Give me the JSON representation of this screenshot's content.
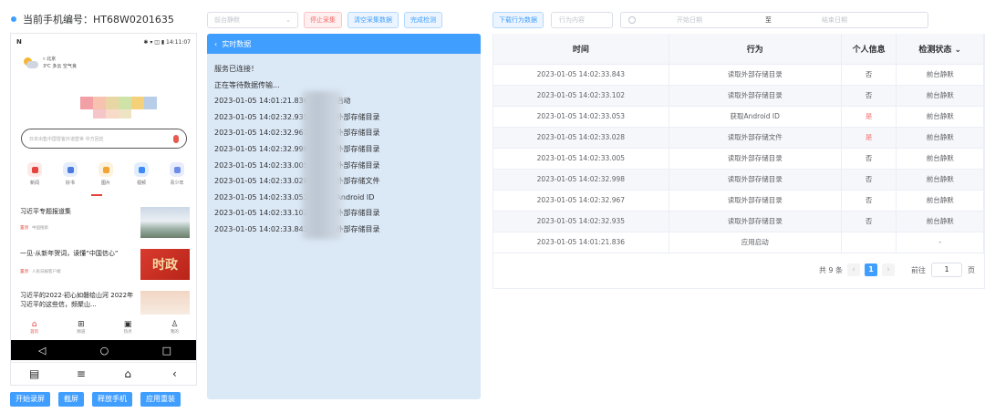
{
  "device": {
    "label": "当前手机编号：HT68W0201635",
    "status_bar": {
      "left": "N",
      "right": "✱ ▾ ◫ ▮ 14:11:07"
    },
    "weather": {
      "city": "▿ 北京",
      "info": "3℃ 多云 空气良"
    },
    "search_placeholder": "日本出售中国冒客外道塑世 中方回应",
    "icons": [
      {
        "label": "新闻",
        "bg": "#fde9e8",
        "fg": "#e5433b"
      },
      {
        "label": "好书",
        "bg": "#e6eefc",
        "fg": "#4a7be0"
      },
      {
        "label": "图片",
        "bg": "#fdf2de",
        "fg": "#f0a532"
      },
      {
        "label": "视频",
        "bg": "#e3eefd",
        "fg": "#3d8af7"
      },
      {
        "label": "青少年",
        "bg": "#e7edfc",
        "fg": "#6e8de8"
      }
    ],
    "news": [
      {
        "title": "习近平专题报道集",
        "tag": "置顶",
        "source": "中国搜索"
      },
      {
        "title": "一见·从新年贺词，读懂“中国信心”",
        "tag": "置顶",
        "source": "人民日报客户端",
        "img_text": "时政"
      },
      {
        "title": "习近平的2022·初心如磐绘山河 2022年习近平的这些信，频聚山...",
        "tag": "置顶",
        "source": "人民日报"
      }
    ],
    "bottom_nav": [
      {
        "label": "首页",
        "glyph": "⌂"
      },
      {
        "label": "频道",
        "glyph": "⊞"
      },
      {
        "label": "热点",
        "glyph": "▣"
      },
      {
        "label": "我的",
        "glyph": "♙"
      }
    ],
    "sys_nav": [
      "◁",
      "○",
      "□"
    ],
    "controls": [
      "▤",
      "≡",
      "⌂",
      "‹"
    ],
    "buttons": [
      "开始录屏",
      "截屏",
      "释放手机",
      "应用重装"
    ]
  },
  "toolbar": {
    "select_placeholder": "前台静默",
    "stop_label": "停止采集",
    "clear_label": "清空采集数据",
    "done_label": "完成检测"
  },
  "realtime": {
    "header": "实时数据",
    "lines": [
      "服务已连接！",
      "正在等待数据传输...",
      "2023-01-05 14:01:21.836 -> 应用启动",
      "2023-01-05 14:02:32.935 -> 读取外部存储目录",
      "2023-01-05 14:02:32.967 -> 读取外部存储目录",
      "2023-01-05 14:02:32.998 -> 读取外部存储目录",
      "2023-01-05 14:02:33.005 -> 读取外部存储目录",
      "2023-01-05 14:02:33.028 -> 读取外部存储文件",
      "2023-01-05 14:02:33.053 -> 获取Android ID",
      "2023-01-05 14:02:33.102 -> 读取外部存储目录",
      "2023-01-05 14:02:33.843 -> 读取外部存储目录"
    ]
  },
  "filters": {
    "download_label": "下载行为数据",
    "behavior_placeholder": "行为内容",
    "start_placeholder": "开始日期",
    "to": "至",
    "end_placeholder": "结束日期"
  },
  "table": {
    "columns": [
      "时间",
      "行为",
      "个人信息",
      "检测状态"
    ],
    "sort_glyph": "⌄",
    "rows": [
      {
        "time": "2023-01-05 14:02:33.843",
        "action": "读取外部存储目录",
        "personal": "否",
        "status": "前台静默"
      },
      {
        "time": "2023-01-05 14:02:33.102",
        "action": "读取外部存储目录",
        "personal": "否",
        "status": "前台静默"
      },
      {
        "time": "2023-01-05 14:02:33.053",
        "action": "获取Android ID",
        "personal": "是",
        "status": "前台静默"
      },
      {
        "time": "2023-01-05 14:02:33.028",
        "action": "读取外部存储文件",
        "personal": "是",
        "status": "前台静默"
      },
      {
        "time": "2023-01-05 14:02:33.005",
        "action": "读取外部存储目录",
        "personal": "否",
        "status": "前台静默"
      },
      {
        "time": "2023-01-05 14:02:32.998",
        "action": "读取外部存储目录",
        "personal": "否",
        "status": "前台静默"
      },
      {
        "time": "2023-01-05 14:02:32.967",
        "action": "读取外部存储目录",
        "personal": "否",
        "status": "前台静默"
      },
      {
        "time": "2023-01-05 14:02:32.935",
        "action": "读取外部存储目录",
        "personal": "否",
        "status": "前台静默"
      },
      {
        "time": "2023-01-05 14:01:21.836",
        "action": "应用启动",
        "personal": "",
        "status": "-"
      }
    ]
  },
  "pagination": {
    "total": "共 9 条",
    "current": "1",
    "goto": "前往",
    "page_value": "1",
    "page_suffix": "页",
    "prev": "‹",
    "next": "›"
  },
  "colors": {
    "primary": "#409eff",
    "danger": "#f56c6c",
    "panel_bg": "#dbe8f6"
  }
}
